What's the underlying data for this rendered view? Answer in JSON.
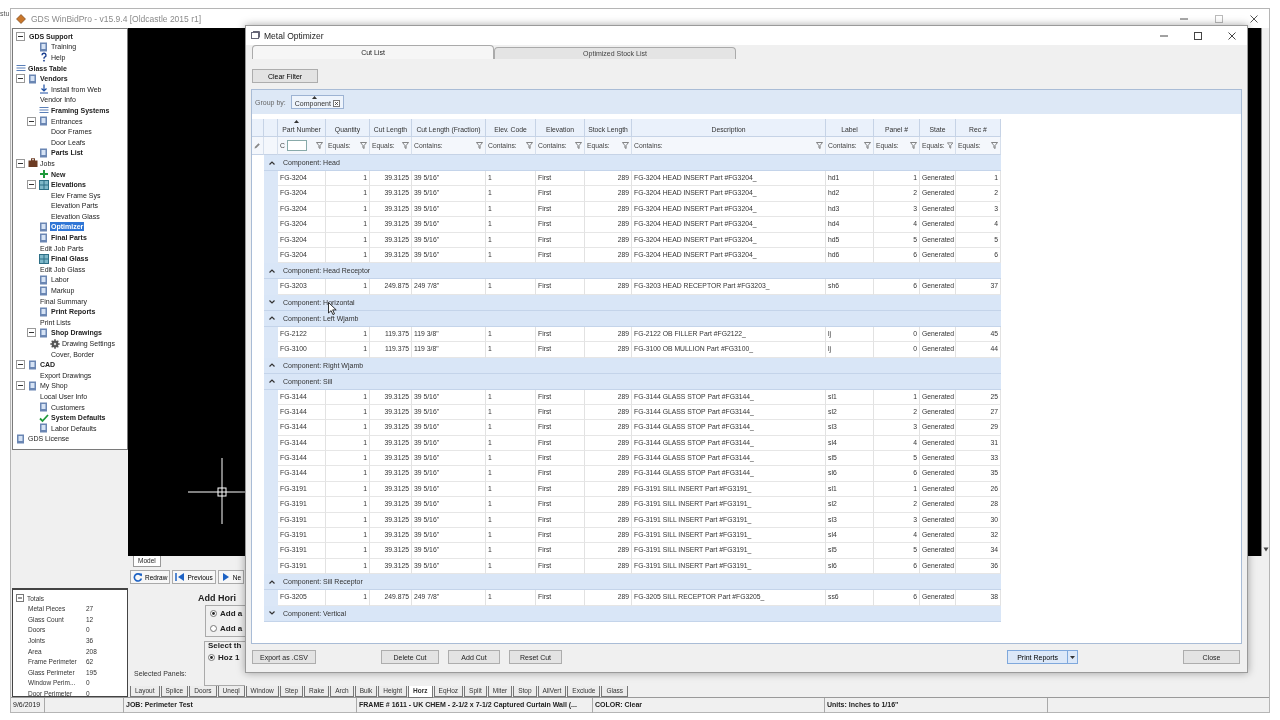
{
  "desktop_text": "stu",
  "app": {
    "title": "GDS WinBidPro - v15.9.4 [Oldcastle 2015 r1]",
    "tree": [
      {
        "label": "GDS Support",
        "kind": "none",
        "bold": true,
        "selected": false,
        "expanded": true,
        "children": [
          {
            "label": "Training",
            "kind": "doc",
            "bold": false,
            "selected": false
          },
          {
            "label": "Help",
            "kind": "help",
            "bold": false,
            "selected": false
          }
        ]
      },
      {
        "label": "Glass Table",
        "kind": "list",
        "bold": true,
        "selected": false
      },
      {
        "label": "Vendors",
        "kind": "doc",
        "bold": true,
        "selected": false,
        "expanded": true,
        "children": [
          {
            "label": "Install from Web",
            "kind": "download",
            "bold": false,
            "selected": false
          },
          {
            "label": "Vendor Info",
            "kind": "none",
            "bold": false,
            "selected": false
          },
          {
            "label": "Framing Systems",
            "kind": "list",
            "bold": true,
            "selected": false
          },
          {
            "label": "Entrances",
            "kind": "doc",
            "bold": false,
            "selected": false,
            "expanded": true,
            "children": [
              {
                "label": "Door Frames",
                "kind": "none",
                "bold": false,
                "selected": false
              },
              {
                "label": "Door Leafs",
                "kind": "none",
                "bold": false,
                "selected": false
              }
            ]
          },
          {
            "label": "Parts List",
            "kind": "doc",
            "bold": true,
            "selected": false
          }
        ]
      },
      {
        "label": "Jobs",
        "kind": "case",
        "bold": false,
        "selected": false,
        "expanded": true,
        "children": [
          {
            "label": "New",
            "kind": "plus",
            "bold": true,
            "selected": false
          },
          {
            "label": "Elevations",
            "kind": "grid",
            "bold": true,
            "selected": false,
            "expanded": true,
            "children": [
              {
                "label": "Elev Frame Sys",
                "kind": "none",
                "bold": false,
                "selected": false
              },
              {
                "label": "Elevation Parts",
                "kind": "none",
                "bold": false,
                "selected": false
              },
              {
                "label": "Elevation Glass",
                "kind": "none",
                "bold": false,
                "selected": false
              }
            ]
          },
          {
            "label": "Optimizer",
            "kind": "doc",
            "bold": true,
            "selected": true
          },
          {
            "label": "Final Parts",
            "kind": "doc",
            "bold": true,
            "selected": false
          },
          {
            "label": "Edit Job Parts",
            "kind": "none",
            "bold": false,
            "selected": false
          },
          {
            "label": "Final Glass",
            "kind": "grid",
            "bold": true,
            "selected": false
          },
          {
            "label": "Edit Job Glass",
            "kind": "none",
            "bold": false,
            "selected": false
          },
          {
            "label": "Labor",
            "kind": "doc",
            "bold": false,
            "selected": false
          },
          {
            "label": "Markup",
            "kind": "doc",
            "bold": false,
            "selected": false
          },
          {
            "label": "Final Summary",
            "kind": "none",
            "bold": false,
            "selected": false
          },
          {
            "label": "Print Reports",
            "kind": "doc",
            "bold": true,
            "selected": false
          },
          {
            "label": "Print Lists",
            "kind": "none",
            "bold": false,
            "selected": false
          },
          {
            "label": "Shop Drawings",
            "kind": "doc",
            "bold": true,
            "selected": false,
            "expanded": true,
            "children": [
              {
                "label": "Drawing Settings",
                "kind": "gear",
                "bold": false,
                "selected": false
              },
              {
                "label": "Cover, Border",
                "kind": "none",
                "bold": false,
                "selected": false
              }
            ]
          }
        ]
      },
      {
        "label": "CAD",
        "kind": "doc",
        "bold": true,
        "selected": false,
        "expanded": true,
        "children": [
          {
            "label": "Export Drawings",
            "kind": "none",
            "bold": false,
            "selected": false
          }
        ]
      },
      {
        "label": "My Shop",
        "kind": "doc",
        "bold": false,
        "selected": false,
        "expanded": true,
        "children": [
          {
            "label": "Local User Info",
            "kind": "none",
            "bold": false,
            "selected": false
          },
          {
            "label": "Customers",
            "kind": "doc",
            "bold": false,
            "selected": false
          },
          {
            "label": "System Defaults",
            "kind": "check",
            "bold": true,
            "selected": false
          },
          {
            "label": "Labor Defaults",
            "kind": "doc",
            "bold": false,
            "selected": false
          }
        ]
      },
      {
        "label": "GDS License",
        "kind": "doc",
        "bold": false,
        "selected": false
      }
    ],
    "cad_tab": "Model",
    "toolbar": [
      {
        "label": "Redraw",
        "kind": "redraw"
      },
      {
        "label": "Previous",
        "kind": "previous"
      },
      {
        "label": "Ne",
        "kind": "next"
      }
    ],
    "totals": {
      "title": "Totals",
      "expanded": true,
      "items": [
        {
          "label": "Metal Pieces",
          "value": "27"
        },
        {
          "label": "Glass Count",
          "value": "12"
        },
        {
          "label": "Doors",
          "value": "0"
        },
        {
          "label": "Joints",
          "value": "36"
        },
        {
          "label": "Area",
          "value": "208"
        },
        {
          "label": "Frame Perimeter",
          "value": "62"
        },
        {
          "label": "Glass Perimeter",
          "value": "195"
        },
        {
          "label": "Window Perim...",
          "value": "0"
        },
        {
          "label": "Door Perimeter",
          "value": "0"
        }
      ]
    },
    "panel": {
      "heading": "Add Hori",
      "options": [
        {
          "label": "Add a",
          "selected": true
        },
        {
          "label": "Add a",
          "selected": false
        }
      ],
      "select_heading": "Select th",
      "select_options": [
        {
          "label": "Hoz 1",
          "selected": true
        }
      ],
      "selected_panels_label": "Selected Panels:"
    },
    "bottom_tabs": [
      {
        "label": "Layout",
        "selected": false
      },
      {
        "label": "Splice",
        "selected": false
      },
      {
        "label": "Doors",
        "selected": false
      },
      {
        "label": "Uneql",
        "selected": false
      },
      {
        "label": "Window",
        "selected": false
      },
      {
        "label": "Step",
        "selected": false
      },
      {
        "label": "Rake",
        "selected": false
      },
      {
        "label": "Arch",
        "selected": false
      },
      {
        "label": "Bulk",
        "selected": false
      },
      {
        "label": "Height",
        "selected": false
      },
      {
        "label": "Horz",
        "selected": true
      },
      {
        "label": "EqHoz",
        "selected": false
      },
      {
        "label": "Split",
        "selected": false
      },
      {
        "label": "Miter",
        "selected": false
      },
      {
        "label": "Stop",
        "selected": false
      },
      {
        "label": "AllVert",
        "selected": false
      },
      {
        "label": "Exclude",
        "selected": false
      },
      {
        "label": "Glass",
        "selected": false
      }
    ],
    "status_bar": [
      "9/6/2019",
      "JOB: Perimeter Test",
      "FRAME # 1611 - UK CHEM - 2-1/2 x 7-1/2 Captured Curtain Wall (...",
      "COLOR: Clear",
      "Units: Inches to 1/16\""
    ]
  },
  "dialog": {
    "title": "Metal Optimizer",
    "tabs": [
      {
        "label": "Cut List",
        "selected": true
      },
      {
        "label": "Optimized Stock List",
        "selected": false
      }
    ],
    "clear_filter": "Clear Filter",
    "group_by": {
      "label": "Group by:",
      "chip": "Component",
      "sorted": true
    },
    "columns": [
      {
        "label": "Part Number",
        "kind": "text",
        "sorted": true,
        "filter": {
          "kind": "input",
          "operator": "C"
        }
      },
      {
        "label": "Quantity",
        "kind": "number",
        "sorted": false,
        "filter": {
          "kind": "operator",
          "operator": "Equals:"
        }
      },
      {
        "label": "Cut Length",
        "kind": "number",
        "sorted": false,
        "filter": {
          "kind": "operator",
          "operator": "Equals:"
        }
      },
      {
        "label": "Cut Length (Fraction)",
        "kind": "text",
        "sorted": false,
        "filter": {
          "kind": "operator",
          "operator": "Contains:"
        }
      },
      {
        "label": "Elev. Code",
        "kind": "text",
        "sorted": false,
        "filter": {
          "kind": "operator",
          "operator": "Contains:"
        }
      },
      {
        "label": "Elevation",
        "kind": "text",
        "sorted": false,
        "filter": {
          "kind": "operator",
          "operator": "Contains:"
        }
      },
      {
        "label": "Stock Length",
        "kind": "number",
        "sorted": false,
        "filter": {
          "kind": "operator",
          "operator": "Equals:"
        }
      },
      {
        "label": "Description",
        "kind": "text",
        "sorted": false,
        "filter": {
          "kind": "operator",
          "operator": "Contains:"
        }
      },
      {
        "label": "Label",
        "kind": "text",
        "sorted": false,
        "filter": {
          "kind": "operator",
          "operator": "Contains:"
        }
      },
      {
        "label": "Panel #",
        "kind": "number",
        "sorted": false,
        "filter": {
          "kind": "operator",
          "operator": "Equals:"
        }
      },
      {
        "label": "State",
        "kind": "text",
        "sorted": false,
        "filter": {
          "kind": "operator",
          "operator": "Equals:"
        }
      },
      {
        "label": "Rec #",
        "kind": "number",
        "sorted": false,
        "filter": {
          "kind": "operator",
          "operator": "Equals:"
        }
      }
    ],
    "groups": [
      {
        "label": "Component: Head",
        "expanded": true,
        "rows": [
          [
            "FG-3204",
            "1",
            "39.3125",
            "39 5/16\"",
            "1",
            "First",
            "289",
            "FG-3204 HEAD INSERT Part #FG3204_",
            "hd1",
            "1",
            "Generated",
            "1"
          ],
          [
            "FG-3204",
            "1",
            "39.3125",
            "39 5/16\"",
            "1",
            "First",
            "289",
            "FG-3204 HEAD INSERT Part #FG3204_",
            "hd2",
            "2",
            "Generated",
            "2"
          ],
          [
            "FG-3204",
            "1",
            "39.3125",
            "39 5/16\"",
            "1",
            "First",
            "289",
            "FG-3204 HEAD INSERT Part #FG3204_",
            "hd3",
            "3",
            "Generated",
            "3"
          ],
          [
            "FG-3204",
            "1",
            "39.3125",
            "39 5/16\"",
            "1",
            "First",
            "289",
            "FG-3204 HEAD INSERT Part #FG3204_",
            "hd4",
            "4",
            "Generated",
            "4"
          ],
          [
            "FG-3204",
            "1",
            "39.3125",
            "39 5/16\"",
            "1",
            "First",
            "289",
            "FG-3204 HEAD INSERT Part #FG3204_",
            "hd5",
            "5",
            "Generated",
            "5"
          ],
          [
            "FG-3204",
            "1",
            "39.3125",
            "39 5/16\"",
            "1",
            "First",
            "289",
            "FG-3204 HEAD INSERT Part #FG3204_",
            "hd6",
            "6",
            "Generated",
            "6"
          ]
        ]
      },
      {
        "label": "Component: Head Receptor",
        "expanded": true,
        "rows": [
          [
            "FG-3203",
            "1",
            "249.875",
            "249 7/8\"",
            "1",
            "First",
            "289",
            "FG-3203 HEAD RECEPTOR Part #FG3203_",
            "sh6",
            "6",
            "Generated",
            "37"
          ]
        ]
      },
      {
        "label": "Component: Horizontal",
        "expanded": false
      },
      {
        "label": "Component: Left Wjamb",
        "expanded": true,
        "rows": [
          [
            "FG-2122",
            "1",
            "119.375",
            "119 3/8\"",
            "1",
            "First",
            "289",
            "FG-2122 OB FILLER Part #FG2122_",
            "lj",
            "0",
            "Generated",
            "45"
          ],
          [
            "FG-3100",
            "1",
            "119.375",
            "119 3/8\"",
            "1",
            "First",
            "289",
            "FG-3100 OB MULLION Part #FG3100_",
            "lj",
            "0",
            "Generated",
            "44"
          ]
        ]
      },
      {
        "label": "Component: Right Wjamb",
        "expanded": true
      },
      {
        "label": "Component: Sill",
        "expanded": true,
        "rows": [
          [
            "FG-3144",
            "1",
            "39.3125",
            "39 5/16\"",
            "1",
            "First",
            "289",
            "FG-3144 GLASS STOP Part #FG3144_",
            "sl1",
            "1",
            "Generated",
            "25"
          ],
          [
            "FG-3144",
            "1",
            "39.3125",
            "39 5/16\"",
            "1",
            "First",
            "289",
            "FG-3144 GLASS STOP Part #FG3144_",
            "sl2",
            "2",
            "Generated",
            "27"
          ],
          [
            "FG-3144",
            "1",
            "39.3125",
            "39 5/16\"",
            "1",
            "First",
            "289",
            "FG-3144 GLASS STOP Part #FG3144_",
            "sl3",
            "3",
            "Generated",
            "29"
          ],
          [
            "FG-3144",
            "1",
            "39.3125",
            "39 5/16\"",
            "1",
            "First",
            "289",
            "FG-3144 GLASS STOP Part #FG3144_",
            "sl4",
            "4",
            "Generated",
            "31"
          ],
          [
            "FG-3144",
            "1",
            "39.3125",
            "39 5/16\"",
            "1",
            "First",
            "289",
            "FG-3144 GLASS STOP Part #FG3144_",
            "sl5",
            "5",
            "Generated",
            "33"
          ],
          [
            "FG-3144",
            "1",
            "39.3125",
            "39 5/16\"",
            "1",
            "First",
            "289",
            "FG-3144 GLASS STOP Part #FG3144_",
            "sl6",
            "6",
            "Generated",
            "35"
          ],
          [
            "FG-3191",
            "1",
            "39.3125",
            "39 5/16\"",
            "1",
            "First",
            "289",
            "FG-3191 SILL INSERT Part #FG3191_",
            "sl1",
            "1",
            "Generated",
            "26"
          ],
          [
            "FG-3191",
            "1",
            "39.3125",
            "39 5/16\"",
            "1",
            "First",
            "289",
            "FG-3191 SILL INSERT Part #FG3191_",
            "sl2",
            "2",
            "Generated",
            "28"
          ],
          [
            "FG-3191",
            "1",
            "39.3125",
            "39 5/16\"",
            "1",
            "First",
            "289",
            "FG-3191 SILL INSERT Part #FG3191_",
            "sl3",
            "3",
            "Generated",
            "30"
          ],
          [
            "FG-3191",
            "1",
            "39.3125",
            "39 5/16\"",
            "1",
            "First",
            "289",
            "FG-3191 SILL INSERT Part #FG3191_",
            "sl4",
            "4",
            "Generated",
            "32"
          ],
          [
            "FG-3191",
            "1",
            "39.3125",
            "39 5/16\"",
            "1",
            "First",
            "289",
            "FG-3191 SILL INSERT Part #FG3191_",
            "sl5",
            "5",
            "Generated",
            "34"
          ],
          [
            "FG-3191",
            "1",
            "39.3125",
            "39 5/16\"",
            "1",
            "First",
            "289",
            "FG-3191 SILL INSERT Part #FG3191_",
            "sl6",
            "6",
            "Generated",
            "36"
          ]
        ]
      },
      {
        "label": "Component: Sill Receptor",
        "expanded": true,
        "rows": [
          [
            "FG-3205",
            "1",
            "249.875",
            "249 7/8\"",
            "1",
            "First",
            "289",
            "FG-3205 SILL RECEPTOR Part #FG3205_",
            "ss6",
            "6",
            "Generated",
            "38"
          ]
        ]
      },
      {
        "label": "Component: Vertical",
        "expanded": false
      }
    ],
    "buttons": [
      {
        "label": "Export as .CSV",
        "kind": "plain"
      },
      {
        "label": "Delete Cut",
        "kind": "plain"
      },
      {
        "label": "Add Cut",
        "kind": "plain"
      },
      {
        "label": "Reset Cut",
        "kind": "plain"
      },
      {
        "label": "Print Reports",
        "kind": "split"
      },
      {
        "label": "Close",
        "kind": "plain"
      }
    ]
  }
}
